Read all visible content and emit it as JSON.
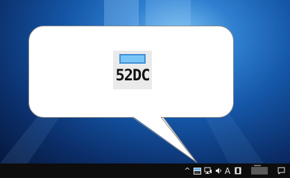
{
  "callout": {
    "icon_glyph": "52DC",
    "icon_name": "ime-tray-icon"
  },
  "taskbar": {
    "show_hidden_icons": "^",
    "language_indicator": "A",
    "colors": {
      "background": "#0d0d0d",
      "text": "#e8e8e8"
    }
  },
  "desktop": {
    "wallpaper": "windows-10-default",
    "colors": {
      "accent": "#2f7fd0"
    }
  }
}
